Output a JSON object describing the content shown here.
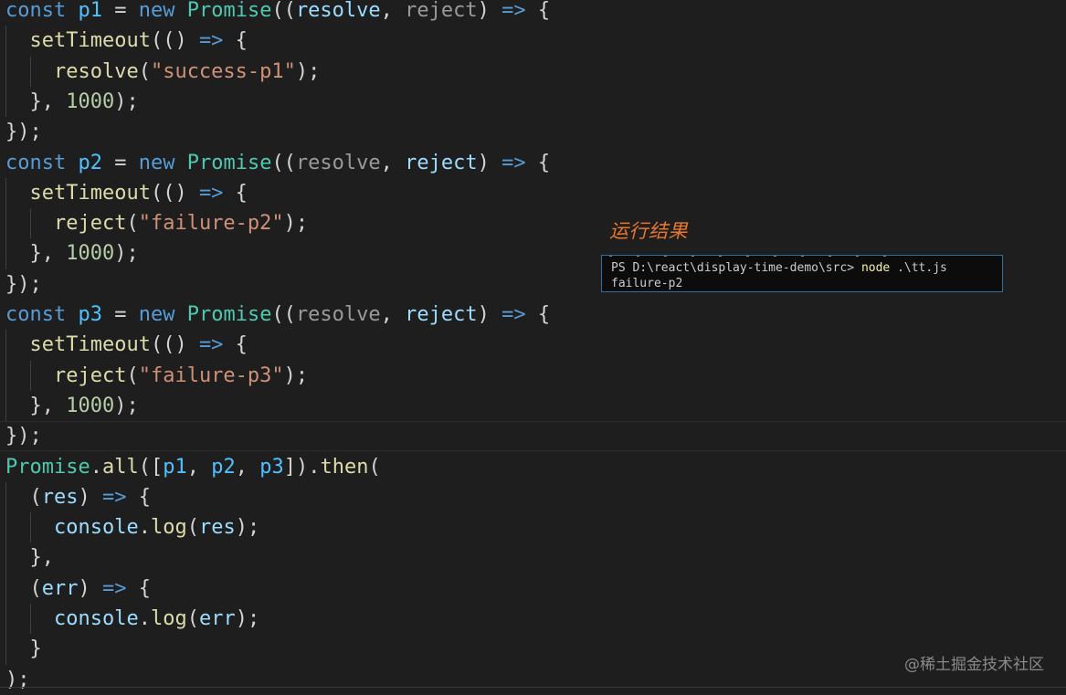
{
  "code": {
    "lines": [
      [
        {
          "t": "const ",
          "c": "kw"
        },
        {
          "t": "p1",
          "c": "var"
        },
        {
          "t": " = ",
          "c": "punc"
        },
        {
          "t": "new ",
          "c": "kw"
        },
        {
          "t": "Promise",
          "c": "cls"
        },
        {
          "t": "((",
          "c": "punc"
        },
        {
          "t": "resolve",
          "c": "param"
        },
        {
          "t": ", ",
          "c": "punc"
        },
        {
          "t": "reject",
          "c": "dim"
        },
        {
          "t": ") ",
          "c": "punc"
        },
        {
          "t": "=>",
          "c": "arrow"
        },
        {
          "t": " {",
          "c": "punc"
        }
      ],
      [
        {
          "t": "  ",
          "c": "punc"
        },
        {
          "t": "setTimeout",
          "c": "fn"
        },
        {
          "t": "(() ",
          "c": "punc"
        },
        {
          "t": "=>",
          "c": "arrow"
        },
        {
          "t": " {",
          "c": "punc"
        }
      ],
      [
        {
          "t": "    ",
          "c": "punc"
        },
        {
          "t": "resolve",
          "c": "fn"
        },
        {
          "t": "(",
          "c": "punc"
        },
        {
          "t": "\"success-p1\"",
          "c": "str"
        },
        {
          "t": ");",
          "c": "punc"
        }
      ],
      [
        {
          "t": "  }, ",
          "c": "punc"
        },
        {
          "t": "1000",
          "c": "num"
        },
        {
          "t": ");",
          "c": "punc"
        }
      ],
      [
        {
          "t": "});",
          "c": "punc"
        }
      ],
      [
        {
          "t": "const ",
          "c": "kw"
        },
        {
          "t": "p2",
          "c": "var"
        },
        {
          "t": " = ",
          "c": "punc"
        },
        {
          "t": "new ",
          "c": "kw"
        },
        {
          "t": "Promise",
          "c": "cls"
        },
        {
          "t": "((",
          "c": "punc"
        },
        {
          "t": "resolve",
          "c": "dim"
        },
        {
          "t": ", ",
          "c": "punc"
        },
        {
          "t": "reject",
          "c": "param"
        },
        {
          "t": ") ",
          "c": "punc"
        },
        {
          "t": "=>",
          "c": "arrow"
        },
        {
          "t": " {",
          "c": "punc"
        }
      ],
      [
        {
          "t": "  ",
          "c": "punc"
        },
        {
          "t": "setTimeout",
          "c": "fn"
        },
        {
          "t": "(() ",
          "c": "punc"
        },
        {
          "t": "=>",
          "c": "arrow"
        },
        {
          "t": " {",
          "c": "punc"
        }
      ],
      [
        {
          "t": "    ",
          "c": "punc"
        },
        {
          "t": "reject",
          "c": "fn"
        },
        {
          "t": "(",
          "c": "punc"
        },
        {
          "t": "\"failure-p2\"",
          "c": "str"
        },
        {
          "t": ");",
          "c": "punc"
        }
      ],
      [
        {
          "t": "  }, ",
          "c": "punc"
        },
        {
          "t": "1000",
          "c": "num"
        },
        {
          "t": ");",
          "c": "punc"
        }
      ],
      [
        {
          "t": "});",
          "c": "punc"
        }
      ],
      [
        {
          "t": "const ",
          "c": "kw"
        },
        {
          "t": "p3",
          "c": "var"
        },
        {
          "t": " = ",
          "c": "punc"
        },
        {
          "t": "new ",
          "c": "kw"
        },
        {
          "t": "Promise",
          "c": "cls"
        },
        {
          "t": "((",
          "c": "punc"
        },
        {
          "t": "resolve",
          "c": "dim"
        },
        {
          "t": ", ",
          "c": "punc"
        },
        {
          "t": "reject",
          "c": "param"
        },
        {
          "t": ") ",
          "c": "punc"
        },
        {
          "t": "=>",
          "c": "arrow"
        },
        {
          "t": " {",
          "c": "punc"
        }
      ],
      [
        {
          "t": "  ",
          "c": "punc"
        },
        {
          "t": "setTimeout",
          "c": "fn"
        },
        {
          "t": "(() ",
          "c": "punc"
        },
        {
          "t": "=>",
          "c": "arrow"
        },
        {
          "t": " {",
          "c": "punc"
        }
      ],
      [
        {
          "t": "    ",
          "c": "punc"
        },
        {
          "t": "reject",
          "c": "fn"
        },
        {
          "t": "(",
          "c": "punc"
        },
        {
          "t": "\"failure-p3\"",
          "c": "str"
        },
        {
          "t": ");",
          "c": "punc"
        }
      ],
      [
        {
          "t": "  }, ",
          "c": "punc"
        },
        {
          "t": "1000",
          "c": "num"
        },
        {
          "t": ");",
          "c": "punc"
        }
      ],
      [
        {
          "t": "});",
          "c": "punc"
        }
      ],
      [
        {
          "t": "Promise",
          "c": "cls"
        },
        {
          "t": ".",
          "c": "punc"
        },
        {
          "t": "all",
          "c": "fn"
        },
        {
          "t": "([",
          "c": "punc"
        },
        {
          "t": "p1",
          "c": "var"
        },
        {
          "t": ", ",
          "c": "punc"
        },
        {
          "t": "p2",
          "c": "var"
        },
        {
          "t": ", ",
          "c": "punc"
        },
        {
          "t": "p3",
          "c": "var"
        },
        {
          "t": "]).",
          "c": "punc"
        },
        {
          "t": "then",
          "c": "fn"
        },
        {
          "t": "(",
          "c": "punc"
        }
      ],
      [
        {
          "t": "  (",
          "c": "punc"
        },
        {
          "t": "res",
          "c": "param"
        },
        {
          "t": ") ",
          "c": "punc"
        },
        {
          "t": "=>",
          "c": "arrow"
        },
        {
          "t": " {",
          "c": "punc"
        }
      ],
      [
        {
          "t": "    ",
          "c": "punc"
        },
        {
          "t": "console",
          "c": "param"
        },
        {
          "t": ".",
          "c": "punc"
        },
        {
          "t": "log",
          "c": "fn"
        },
        {
          "t": "(",
          "c": "punc"
        },
        {
          "t": "res",
          "c": "param"
        },
        {
          "t": ");",
          "c": "punc"
        }
      ],
      [
        {
          "t": "  },",
          "c": "punc"
        }
      ],
      [
        {
          "t": "  (",
          "c": "punc"
        },
        {
          "t": "err",
          "c": "param"
        },
        {
          "t": ") ",
          "c": "punc"
        },
        {
          "t": "=>",
          "c": "arrow"
        },
        {
          "t": " {",
          "c": "punc"
        }
      ],
      [
        {
          "t": "    ",
          "c": "punc"
        },
        {
          "t": "console",
          "c": "param"
        },
        {
          "t": ".",
          "c": "punc"
        },
        {
          "t": "log",
          "c": "fn"
        },
        {
          "t": "(",
          "c": "punc"
        },
        {
          "t": "err",
          "c": "param"
        },
        {
          "t": ");",
          "c": "punc"
        }
      ],
      [
        {
          "t": "  }",
          "c": "punc"
        }
      ],
      [
        {
          "t": ");",
          "c": "punc"
        }
      ]
    ]
  },
  "result": {
    "title": "运行结果",
    "terminal_prompt": "PS D:\\react\\display-time-demo\\src> ",
    "terminal_command": "node",
    "terminal_args": " .\\tt.js",
    "terminal_output": "failure-p2"
  },
  "watermark": "@稀土掘金技术社区",
  "colors": {
    "background": "#1e1e1e",
    "keyword": "#569cd6",
    "string": "#ce9178",
    "number": "#b5cea8",
    "function": "#dcdcaa",
    "class": "#4ec9b0",
    "result_title": "#e8772e"
  }
}
